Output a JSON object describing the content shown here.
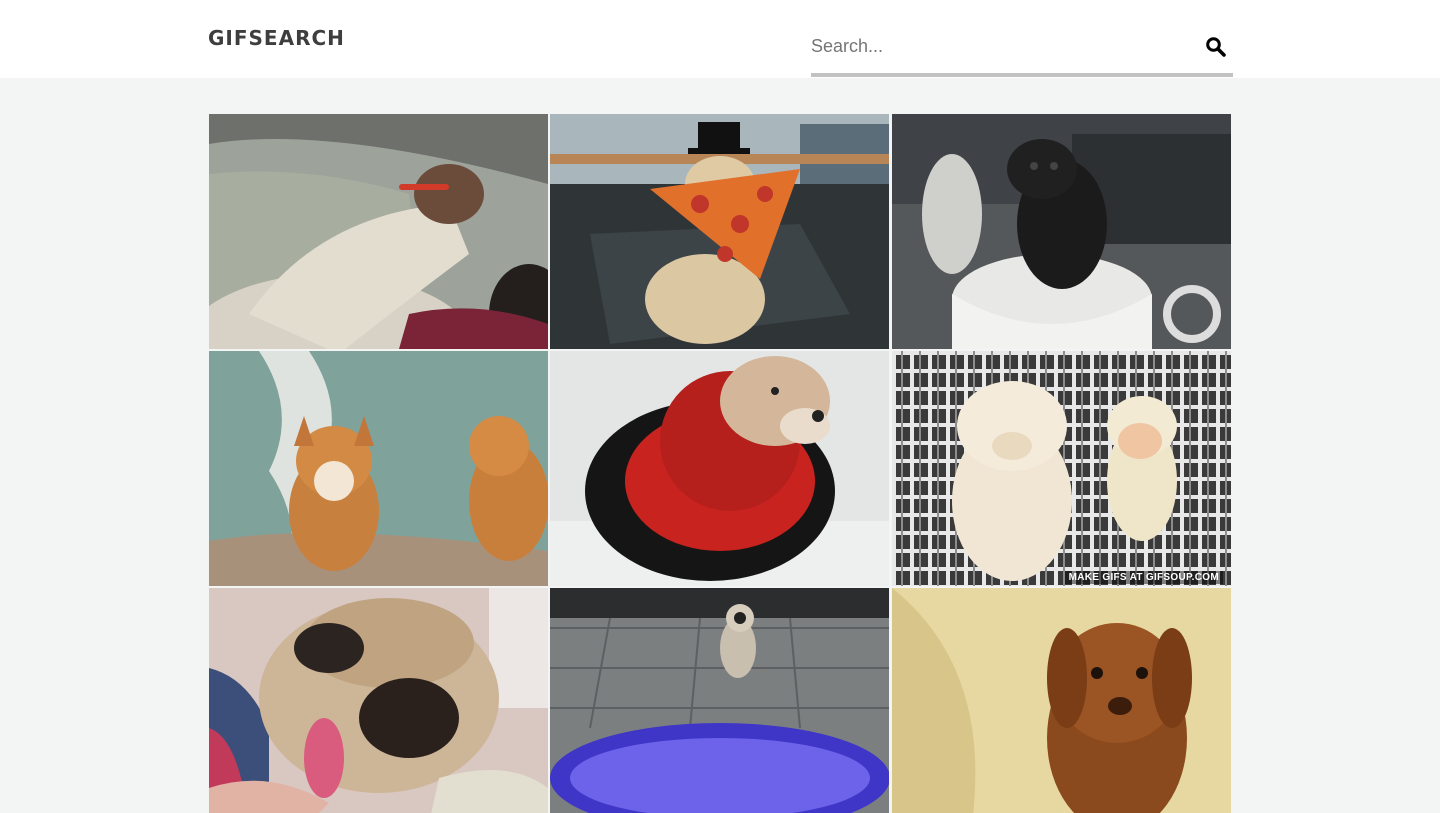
{
  "header": {
    "logo": "GIFSEARCH",
    "search": {
      "placeholder": "Search...",
      "value": "",
      "icon": "search-icon"
    }
  },
  "results": [
    {
      "id": "gif-1",
      "subject": "dog burrowing into bed",
      "watermark": ""
    },
    {
      "id": "gif-2",
      "subject": "dog with top hat and pizza slice",
      "watermark": ""
    },
    {
      "id": "gif-3",
      "subject": "black pug puppy in a teacup",
      "watermark": ""
    },
    {
      "id": "gif-4",
      "subject": "two shiba inu dogs",
      "watermark": ""
    },
    {
      "id": "gif-5",
      "subject": "dog wearing red knitted hood",
      "watermark": ""
    },
    {
      "id": "gif-6",
      "subject": "fluffy puppy sleeping next to doll",
      "watermark": "MAKE GIFS AT GIFSOUP.COM"
    },
    {
      "id": "gif-7",
      "subject": "pug licking a hand",
      "watermark": ""
    },
    {
      "id": "gif-8",
      "subject": "puppy standing in blue pool",
      "watermark": ""
    },
    {
      "id": "gif-9",
      "subject": "brown labrador puppy",
      "watermark": ""
    }
  ]
}
